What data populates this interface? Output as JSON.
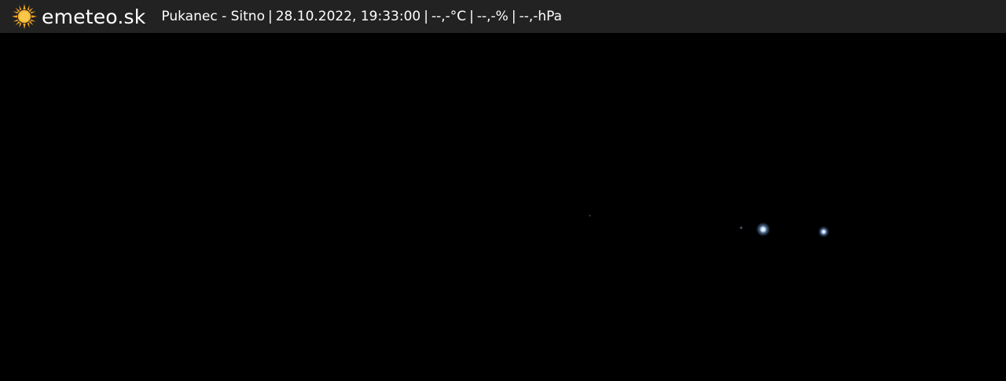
{
  "header": {
    "brand": "emeteo.sk",
    "location": "Pukanec - Sitno",
    "datetime": "28.10.2022, 19:33:00",
    "temperature": "--,-°C",
    "humidity": "--,-%",
    "pressure": "--,-hPa",
    "separator": "|"
  },
  "icons": {
    "logo": "sun-icon"
  },
  "colors": {
    "header_bg": "#222222",
    "text": "#ffffff",
    "sun": "#f5a623",
    "image_bg": "#000000"
  }
}
